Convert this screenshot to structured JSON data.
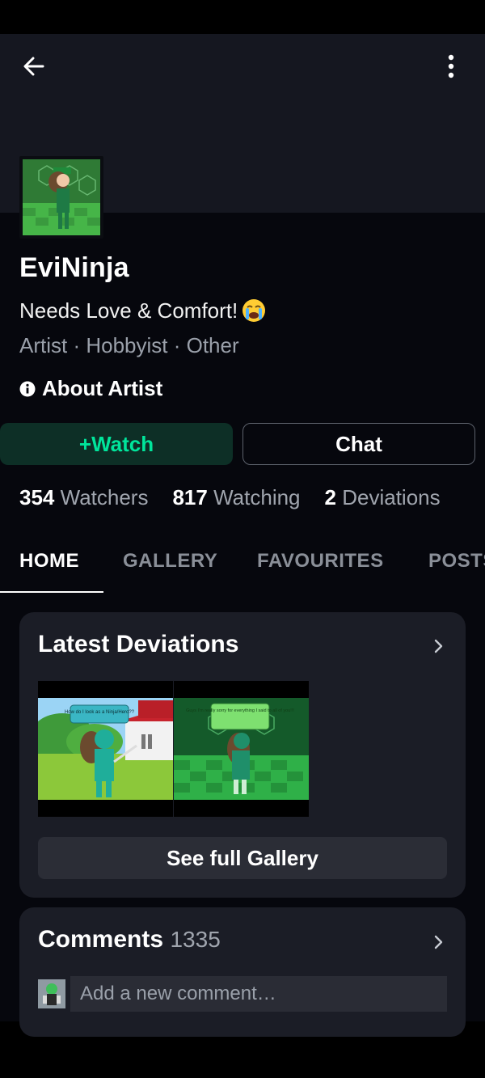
{
  "profile": {
    "username": "EviNinja",
    "tagline": "Needs Love & Comfort!",
    "tagline_emoji": "crying-face-emoji",
    "roles": "Artist · Hobbyist · Other",
    "about_label": "About Artist"
  },
  "actions": {
    "watch_label": "+Watch",
    "chat_label": "Chat"
  },
  "stats": {
    "watchers_count": "354",
    "watchers_label": "Watchers",
    "watching_count": "817",
    "watching_label": "Watching",
    "deviations_count": "2",
    "deviations_label": "Deviations"
  },
  "tabs": [
    {
      "label": "HOME",
      "active": true
    },
    {
      "label": "GALLERY",
      "active": false
    },
    {
      "label": "FAVOURITES",
      "active": false
    },
    {
      "label": "POSTS",
      "active": false
    }
  ],
  "latest": {
    "title": "Latest Deviations",
    "see_gallery_label": "See full Gallery",
    "thumbnails": [
      {
        "caption": "How do I look as a Ninja/Hero??"
      },
      {
        "caption": "Guys I'm really sorry for everything I said to all of you!!!"
      }
    ]
  },
  "comments": {
    "title": "Comments",
    "count": "1335",
    "placeholder": "Add a new comment…"
  },
  "colors": {
    "accent": "#00e59b",
    "background": "#06070d",
    "card": "#1b1d26"
  }
}
